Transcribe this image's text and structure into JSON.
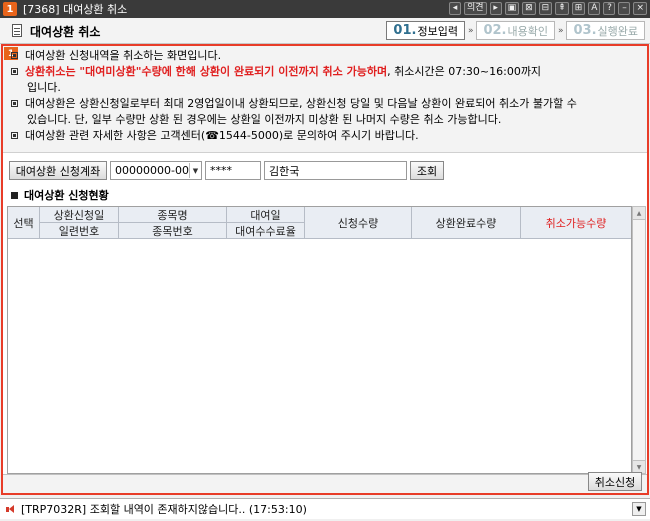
{
  "window": {
    "number": "1",
    "title": "[7368] 대여상환 취소",
    "controls": [
      "◂",
      "의견",
      "▸",
      "▣",
      "⊠",
      "⊟",
      "⇞",
      "⊞",
      "A",
      "?",
      "–",
      "×"
    ]
  },
  "header": {
    "title": "대여상환 취소",
    "steps": [
      {
        "num": "01.",
        "label": "정보입력"
      },
      {
        "num": "02.",
        "label": "내용확인"
      },
      {
        "num": "03.",
        "label": "실행완료"
      }
    ],
    "step_arrow": "»"
  },
  "notice": {
    "badge": "1",
    "line1": "대여상환 신청내역을 취소하는 화면입니다.",
    "line2_red": "상환취소는 \"대여미상환\"수량에 한해 상환이 완료되기 이전까지 취소 가능하며",
    "line2_rest": ", 취소시간은 07:30~16:00까지",
    "line3": "입니다.",
    "line4": "대여상환은 상환신청일로부터 최대 2영업일이내 상환되므로, 상환신청 당일 및 다음날 상환이 완료되어 취소가 불가할 수",
    "line5": "있습니다. 단, 일부 수량만 상환 된 경우에는 상환일 이전까지 미상환 된 나머지 수량은 취소 가능합니다.",
    "line6": "대여상환 관련 자세한 사항은 고객센터(☎1544-5000)로 문의하여 주시기 바랍니다."
  },
  "query": {
    "account_label": "대여상환 신청계좌",
    "account_value": "00000000-00",
    "password_value": "****",
    "name_value": "김한국",
    "search_label": "조회"
  },
  "section_title": "대여상환 신청현황",
  "table": {
    "headers": {
      "select": "선택",
      "apply_date": "상환신청일",
      "serial": "일련번호",
      "stock_name": "종목명",
      "stock_code": "종목번호",
      "loan_date": "대여일",
      "loan_fee_rate": "대여수수료율",
      "req_qty": "신청수량",
      "done_qty": "상환완료수량",
      "cancel_qty": "취소가능수량"
    },
    "rows": []
  },
  "cancel_button": "취소신청",
  "status_message": "[TRP7032R] 조회할 내역이 존재하지않습니다.. (17:53:10)",
  "colors": {
    "accent_red": "#e02020",
    "frame_border": "#e83c28",
    "badge_orange": "#e8641b"
  }
}
